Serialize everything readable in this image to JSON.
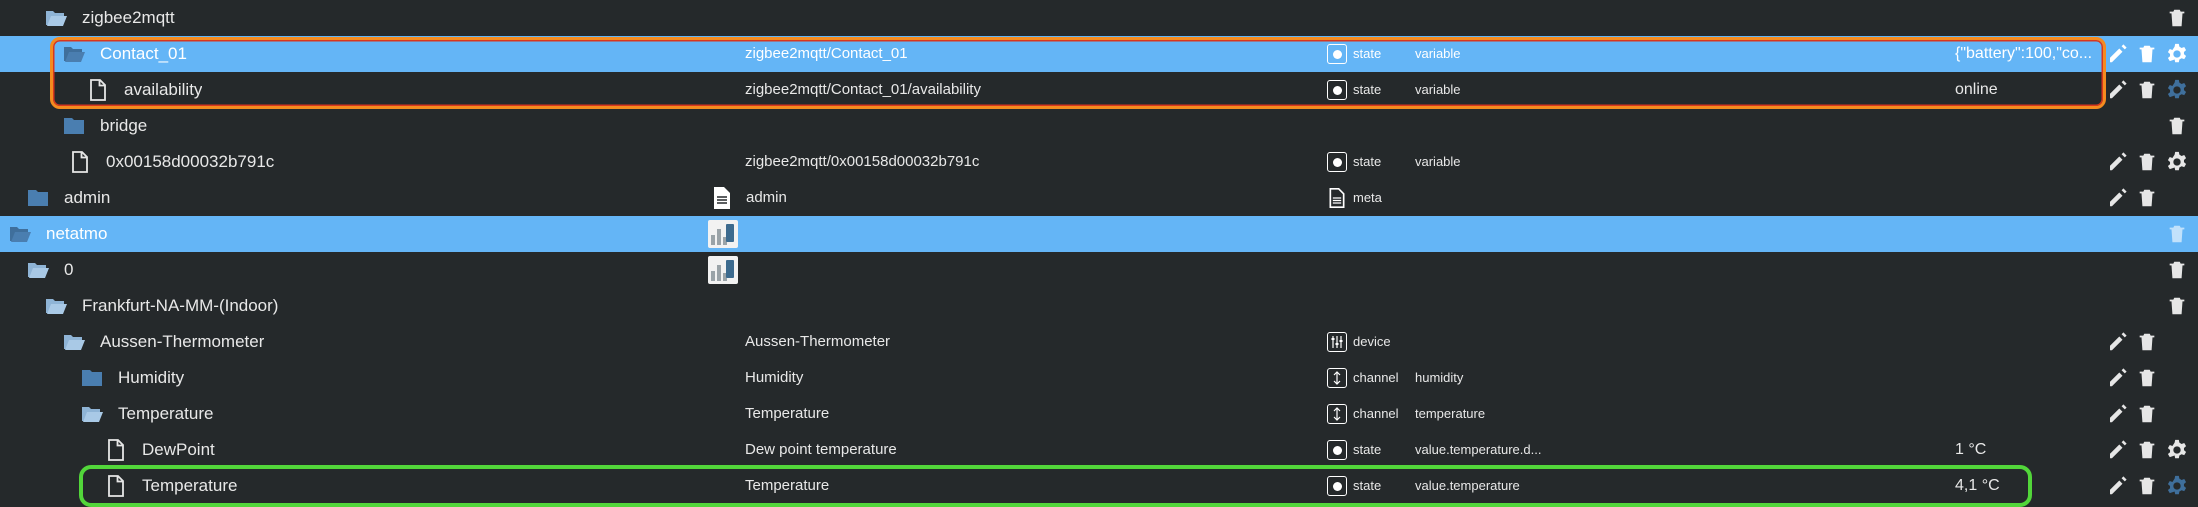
{
  "colors": {
    "background": "#25292b",
    "selected": "#64b5f6",
    "highlight_orange": "#f58b1f",
    "highlight_green": "#52d63a"
  },
  "rows": [
    {
      "name": "zigbee2mqtt",
      "icon": "folder-open-icon",
      "id": "",
      "type": "",
      "type_icon": "",
      "role": "",
      "value": "",
      "actions": [
        "delete"
      ]
    },
    {
      "name": "Contact_01",
      "icon": "folder-open-icon",
      "id": "zigbee2mqtt/Contact_01",
      "type": "state",
      "type_icon": "state-icon",
      "role": "variable",
      "value": "{\"battery\":100,\"co...",
      "actions": [
        "edit",
        "delete",
        "settings"
      ],
      "selected": true
    },
    {
      "name": "availability",
      "icon": "file-icon",
      "id": "zigbee2mqtt/Contact_01/availability",
      "type": "state",
      "type_icon": "state-icon",
      "role": "variable",
      "value": "online",
      "actions": [
        "edit",
        "delete",
        "settings"
      ]
    },
    {
      "name": "bridge",
      "icon": "folder-closed-icon",
      "id": "",
      "type": "",
      "type_icon": "",
      "role": "",
      "value": "",
      "actions": [
        "delete"
      ]
    },
    {
      "name": "0x00158d00032b791c",
      "icon": "file-icon",
      "id": "zigbee2mqtt/0x00158d00032b791c",
      "type": "state",
      "type_icon": "state-icon",
      "role": "variable",
      "value": "",
      "actions": [
        "edit",
        "delete",
        "settings"
      ]
    },
    {
      "name": "admin",
      "icon": "folder-closed-icon",
      "id": "admin",
      "id_icon": "document-icon",
      "type": "meta",
      "type_icon": "document-icon",
      "role": "",
      "value": "",
      "actions": [
        "edit",
        "delete"
      ]
    },
    {
      "name": "netatmo",
      "icon": "folder-open-icon",
      "id": "",
      "thumb": true,
      "type": "",
      "type_icon": "",
      "role": "",
      "value": "",
      "actions": [
        "delete"
      ],
      "selected": true
    },
    {
      "name": "0",
      "icon": "folder-open-icon",
      "id": "",
      "thumb": true,
      "type": "",
      "type_icon": "",
      "role": "",
      "value": "",
      "actions": [
        "delete"
      ]
    },
    {
      "name": "Frankfurt-NA-MM-(Indoor)",
      "icon": "folder-open-icon",
      "id": "",
      "type": "",
      "type_icon": "",
      "role": "",
      "value": "",
      "actions": [
        "delete"
      ]
    },
    {
      "name": "Aussen-Thermometer",
      "icon": "folder-open-icon",
      "id": "Aussen-Thermometer",
      "type": "device",
      "type_icon": "device-icon",
      "role": "",
      "value": "",
      "actions": [
        "edit",
        "delete"
      ]
    },
    {
      "name": "Humidity",
      "icon": "folder-closed-icon",
      "id": "Humidity",
      "type": "channel",
      "type_icon": "channel-icon",
      "role": "humidity",
      "value": "",
      "actions": [
        "edit",
        "delete"
      ]
    },
    {
      "name": "Temperature",
      "icon": "folder-open-icon",
      "id": "Temperature",
      "type": "channel",
      "type_icon": "channel-icon",
      "role": "temperature",
      "value": "",
      "actions": [
        "edit",
        "delete"
      ]
    },
    {
      "name": "DewPoint",
      "icon": "file-icon",
      "id": "Dew point temperature",
      "type": "state",
      "type_icon": "state-icon",
      "role": "value.temperature.d...",
      "value": "1 °C",
      "actions": [
        "edit",
        "delete",
        "settings"
      ]
    },
    {
      "name": "Temperature",
      "icon": "file-icon",
      "id": "Temperature",
      "type": "state",
      "type_icon": "state-icon",
      "role": "value.temperature",
      "value": "4,1 °C",
      "actions": [
        "edit",
        "delete",
        "settings"
      ]
    }
  ]
}
